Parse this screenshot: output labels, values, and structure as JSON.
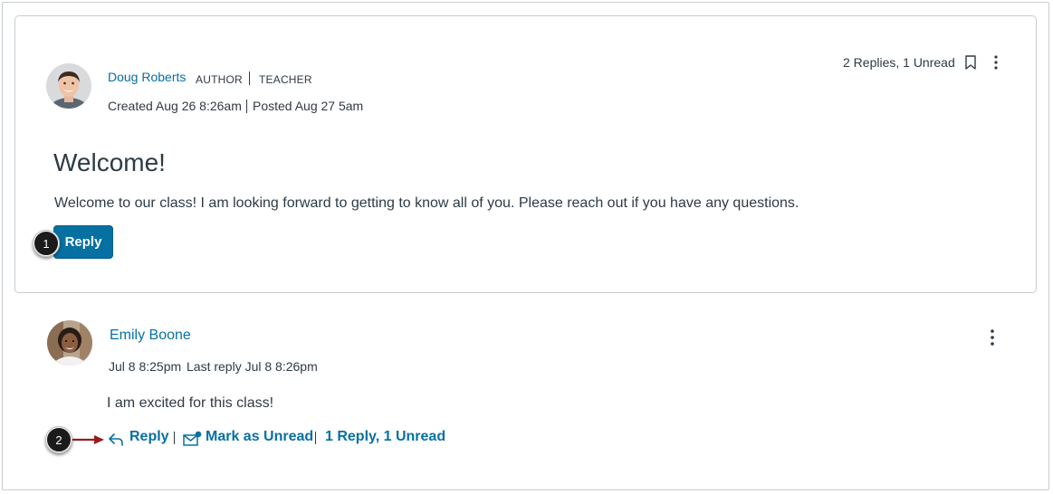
{
  "topic": {
    "author_name": "Doug Roberts",
    "role_author": "AUTHOR",
    "role_teacher": "TEACHER",
    "created": "Created Aug 26 8:26am",
    "posted": "Posted Aug 27 5am",
    "replies_summary": "2 Replies, 1 Unread",
    "title": "Welcome!",
    "message": "Welcome to our class! I am looking forward to getting to know all of you. Please reach out if you have any questions.",
    "reply_label": "Reply",
    "icons": [
      "bookmark-icon",
      "more-options-icon"
    ]
  },
  "entry": {
    "author_name": "Emily Boone",
    "timestamp": "Jul 8 8:25pm",
    "last_reply": "Last reply Jul 8 8:26pm",
    "message": "I am excited for this class!",
    "reply_label": "Reply",
    "mark_unread_label": "Mark as Unread",
    "replies_summary": "1 Reply, 1 Unread",
    "icons": [
      "reply-arrow-icon",
      "mark-unread-icon",
      "more-options-icon"
    ]
  },
  "callouts": [
    "1",
    "2"
  ],
  "colors": {
    "link": "#0770a3",
    "button_bg": "#0770a3",
    "text": "#2d3b45",
    "border": "#c7cdd1",
    "callout_arrow": "#9b1b1e"
  }
}
